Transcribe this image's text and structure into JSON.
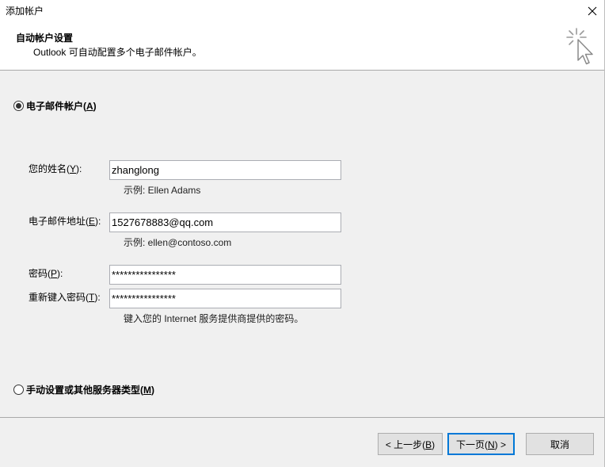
{
  "title_bar": {
    "title": "添加帐户",
    "close_icon": "close-icon"
  },
  "header": {
    "title": "自动帐户设置",
    "subtitle": "Outlook 可自动配置多个电子邮件帐户。",
    "icon": "cursor-sparkle-icon"
  },
  "options": {
    "email_account": {
      "label": {
        "text": "电子邮件帐户(",
        "mnemonic": "A",
        "suffix": ")"
      },
      "selected": true
    },
    "manual_setup": {
      "label": {
        "text": "手动设置或其他服务器类型(",
        "mnemonic": "M",
        "suffix": ")"
      },
      "selected": false
    }
  },
  "form": {
    "name": {
      "label": {
        "text": "您的姓名(",
        "mnemonic": "Y",
        "suffix": "):"
      },
      "value": "zhanglong",
      "hint": "示例: Ellen Adams"
    },
    "email": {
      "label": {
        "text": "电子邮件地址(",
        "mnemonic": "E",
        "suffix": "):"
      },
      "value": "1527678883@qq.com",
      "hint": "示例: ellen@contoso.com"
    },
    "password": {
      "label": {
        "text": "密码(",
        "mnemonic": "P",
        "suffix": "):"
      },
      "value": "****************"
    },
    "retype_password": {
      "label": {
        "text": "重新键入密码(",
        "mnemonic": "T",
        "suffix": "):"
      },
      "value": "****************"
    },
    "password_hint": "键入您的 Internet 服务提供商提供的密码。"
  },
  "buttons": {
    "back": {
      "text": "< 上一步(",
      "mnemonic": "B",
      "suffix": ")"
    },
    "next": {
      "text": "下一页(",
      "mnemonic": "N",
      "suffix": ") >"
    },
    "cancel": {
      "text": "取消"
    }
  },
  "colors": {
    "accent": "#0078d7",
    "panel": "#f0f0f0"
  }
}
